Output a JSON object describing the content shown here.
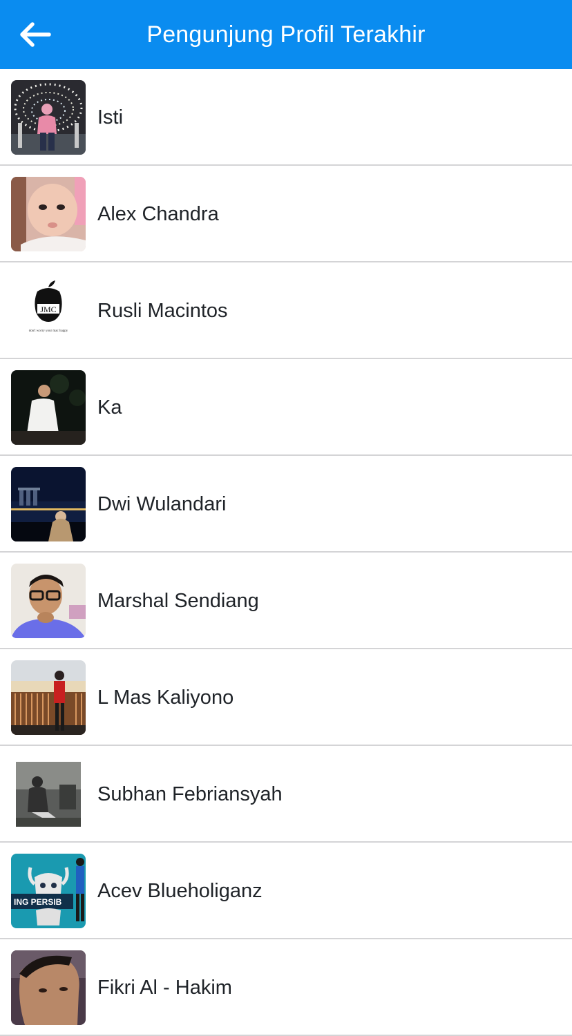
{
  "header": {
    "title": "Pengunjung Profil Terakhir",
    "back_icon": "arrow-left-icon",
    "background_color": "#0a8cf0"
  },
  "visitors": [
    {
      "name": "Isti"
    },
    {
      "name": "Alex Chandra"
    },
    {
      "name": "Rusli Macintos",
      "avatar_text": "JMC",
      "avatar_caption": "don't worry your mac happy"
    },
    {
      "name": "Ka"
    },
    {
      "name": "Dwi Wulandari"
    },
    {
      "name": "Marshal Sendiang"
    },
    {
      "name": "L Mas Kaliyono"
    },
    {
      "name": "Subhan Febriansyah"
    },
    {
      "name": "Acev Blueholiganz",
      "avatar_text": "ING PERSIB"
    },
    {
      "name": "Fikri Al - Hakim"
    }
  ]
}
